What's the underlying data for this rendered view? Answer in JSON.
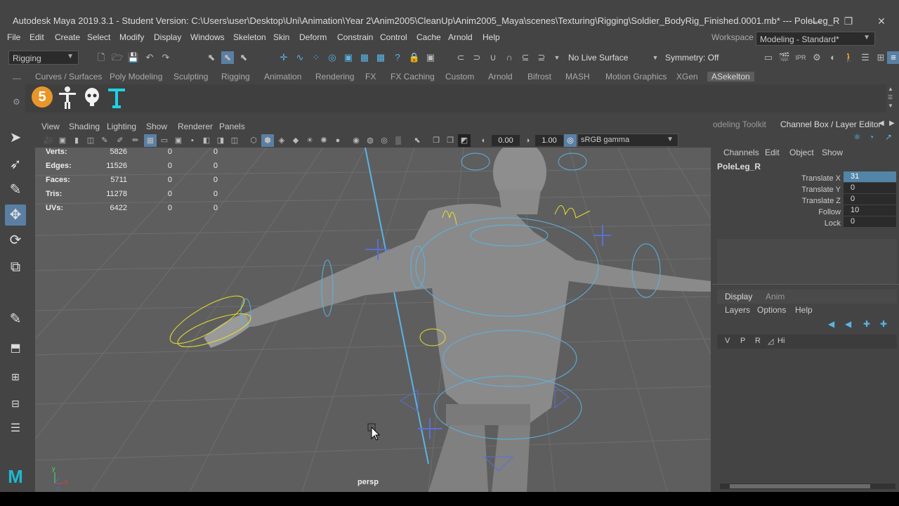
{
  "window": {
    "title": "Autodesk Maya 2019.3.1 - Student Version: C:\\Users\\user\\Desktop\\Uni\\Animation\\Year 2\\Anim2005\\CleanUp\\Anim2005_Maya\\scenes\\Texturing\\Rigging\\Soldier_BodyRig_Finished.0001.mb*  ---  PoleLeg_R",
    "minimize": "—",
    "restore": "❐",
    "close": "✕"
  },
  "menubar": {
    "items": [
      "File",
      "Edit",
      "Create",
      "Select",
      "Modify",
      "Display",
      "Windows",
      "Skeleton",
      "Skin",
      "Deform",
      "Constrain",
      "Control",
      "Cache",
      "Arnold",
      "Help"
    ],
    "workspace_label": "Workspace :",
    "workspace_value": "Modeling - Standard*"
  },
  "statusbar": {
    "menuset": "Rigging",
    "live_surface": "No Live Surface",
    "symmetry": "Symmetry: Off"
  },
  "shelf": {
    "tabs": [
      "Curves / Surfaces",
      "Poly Modeling",
      "Sculpting",
      "Rigging",
      "Animation",
      "Rendering",
      "FX",
      "FX Caching",
      "Custom",
      "Arnold",
      "Bifrost",
      "MASH",
      "Motion Graphics",
      "XGen",
      "ASekelton"
    ],
    "active_tab": "ASekelton",
    "icons": [
      "number-5-icon",
      "tpose-figure-icon",
      "skull-icon",
      "cyan-figure-icon"
    ],
    "badge_number": "5"
  },
  "viewport": {
    "menu": [
      "View",
      "Shading",
      "Lighting",
      "Show",
      "Renderer",
      "Panels"
    ],
    "exposure": "0.00",
    "gamma": "1.00",
    "colorspace": "sRGB gamma",
    "camera_label": "persp",
    "hud": [
      {
        "label": "Verts:",
        "v1": "5826",
        "v2": "0",
        "v3": "0"
      },
      {
        "label": "Edges:",
        "v1": "11526",
        "v2": "0",
        "v3": "0"
      },
      {
        "label": "Faces:",
        "v1": "5711",
        "v2": "0",
        "v3": "0"
      },
      {
        "label": "Tris:",
        "v1": "11278",
        "v2": "0",
        "v3": "0"
      },
      {
        "label": "UVs:",
        "v1": "6422",
        "v2": "0",
        "v3": "0"
      }
    ],
    "axis": {
      "x": "x",
      "y": "y",
      "z": "z"
    }
  },
  "rightpanel": {
    "tabs": [
      "odeling Toolkit",
      "Channel Box / Layer Editor"
    ],
    "cb_menu": [
      "Channels",
      "Edit",
      "Object",
      "Show"
    ],
    "object_name": "PoleLeg_R",
    "attrs": [
      {
        "name": "Translate X",
        "value": "31"
      },
      {
        "name": "Translate Y",
        "value": "0"
      },
      {
        "name": "Translate Z",
        "value": "0"
      },
      {
        "name": "Follow",
        "value": "10"
      },
      {
        "name": "Lock",
        "value": "0"
      }
    ],
    "layer_tabs": [
      "Display",
      "Anim"
    ],
    "layer_menu": [
      "Layers",
      "Options",
      "Help"
    ],
    "layer_row": {
      "v": "V",
      "p": "P",
      "r": "R",
      "name": "Hi"
    }
  },
  "toolbox_logo": "M"
}
